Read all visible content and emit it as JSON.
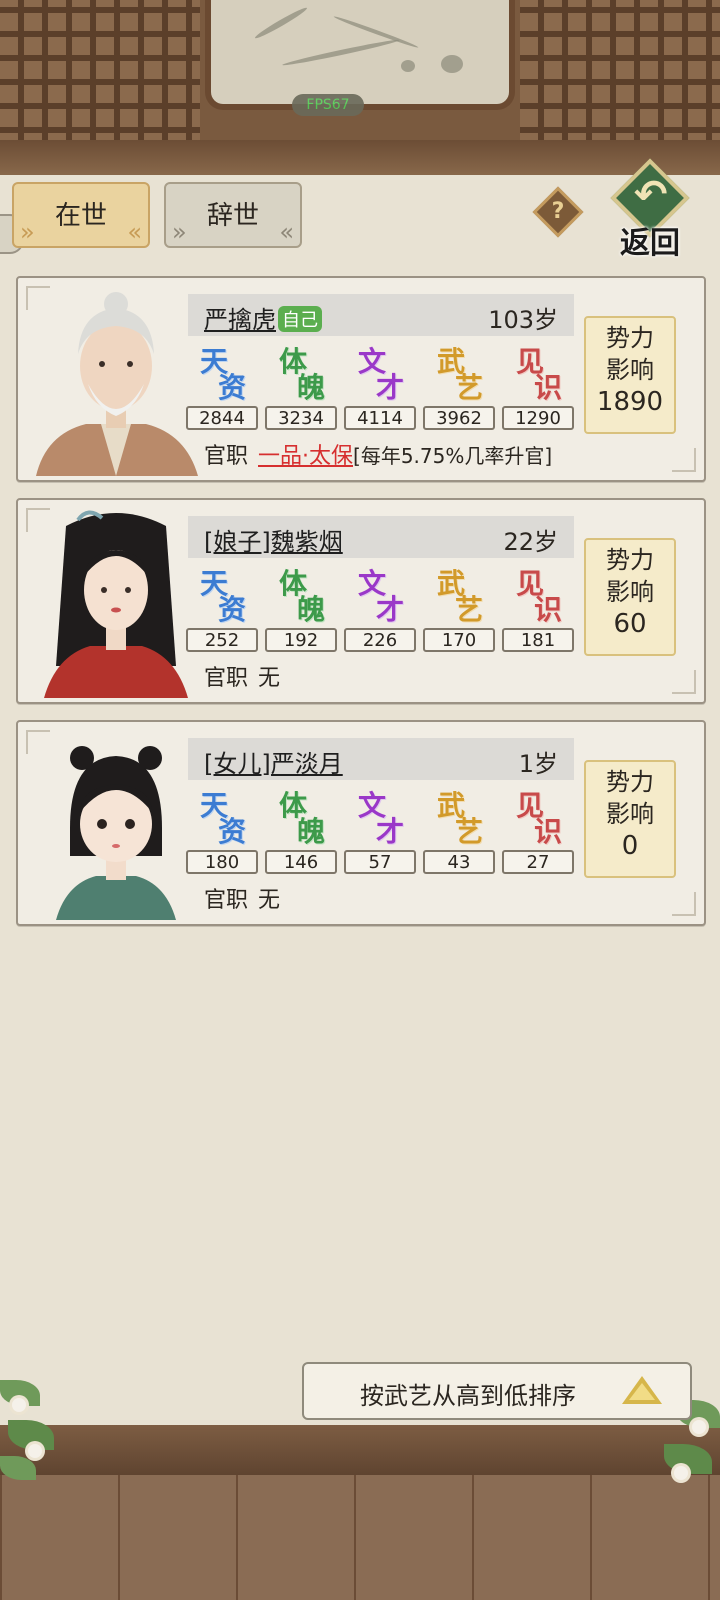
{
  "fps": "FPS67",
  "tabs": {
    "alive": "在世",
    "deceased": "辞世"
  },
  "help": "?",
  "back": {
    "arrow": "↶",
    "label": "返回"
  },
  "stat_labels": [
    {
      "c1": "天",
      "c2": "资"
    },
    {
      "c1": "体",
      "c2": "魄"
    },
    {
      "c1": "文",
      "c2": "才"
    },
    {
      "c1": "武",
      "c2": "艺"
    },
    {
      "c1": "见",
      "c2": "识"
    }
  ],
  "colors": {
    "tian": "#3c7cd2",
    "ti": "#3d9a4a",
    "wen": "#9a38c8",
    "wu": "#d29a2a",
    "jian": "#c84a4a",
    "rank": "#d62f2f"
  },
  "influence_label": {
    "l1": "势力",
    "l2": "影响"
  },
  "office_label": "官职",
  "members": [
    {
      "name": "严擒虎",
      "self_badge": "自己",
      "age": "103岁",
      "stats": [
        "2844",
        "3234",
        "4114",
        "3962",
        "1290"
      ],
      "office_rank": "一品·太保",
      "office_note": "[每年5.75%几率升官]",
      "influence": "1890",
      "portrait": "elderly-man"
    },
    {
      "name": "[娘子]魏紫烟",
      "age": "22岁",
      "stats": [
        "252",
        "192",
        "226",
        "170",
        "181"
      ],
      "office_none": "无",
      "influence": "60",
      "portrait": "young-woman"
    },
    {
      "name": "[女儿]严淡月",
      "age": "1岁",
      "stats": [
        "180",
        "146",
        "57",
        "43",
        "27"
      ],
      "office_none": "无",
      "influence": "0",
      "portrait": "child-girl"
    }
  ],
  "sort_button": "按武艺从高到低排序"
}
